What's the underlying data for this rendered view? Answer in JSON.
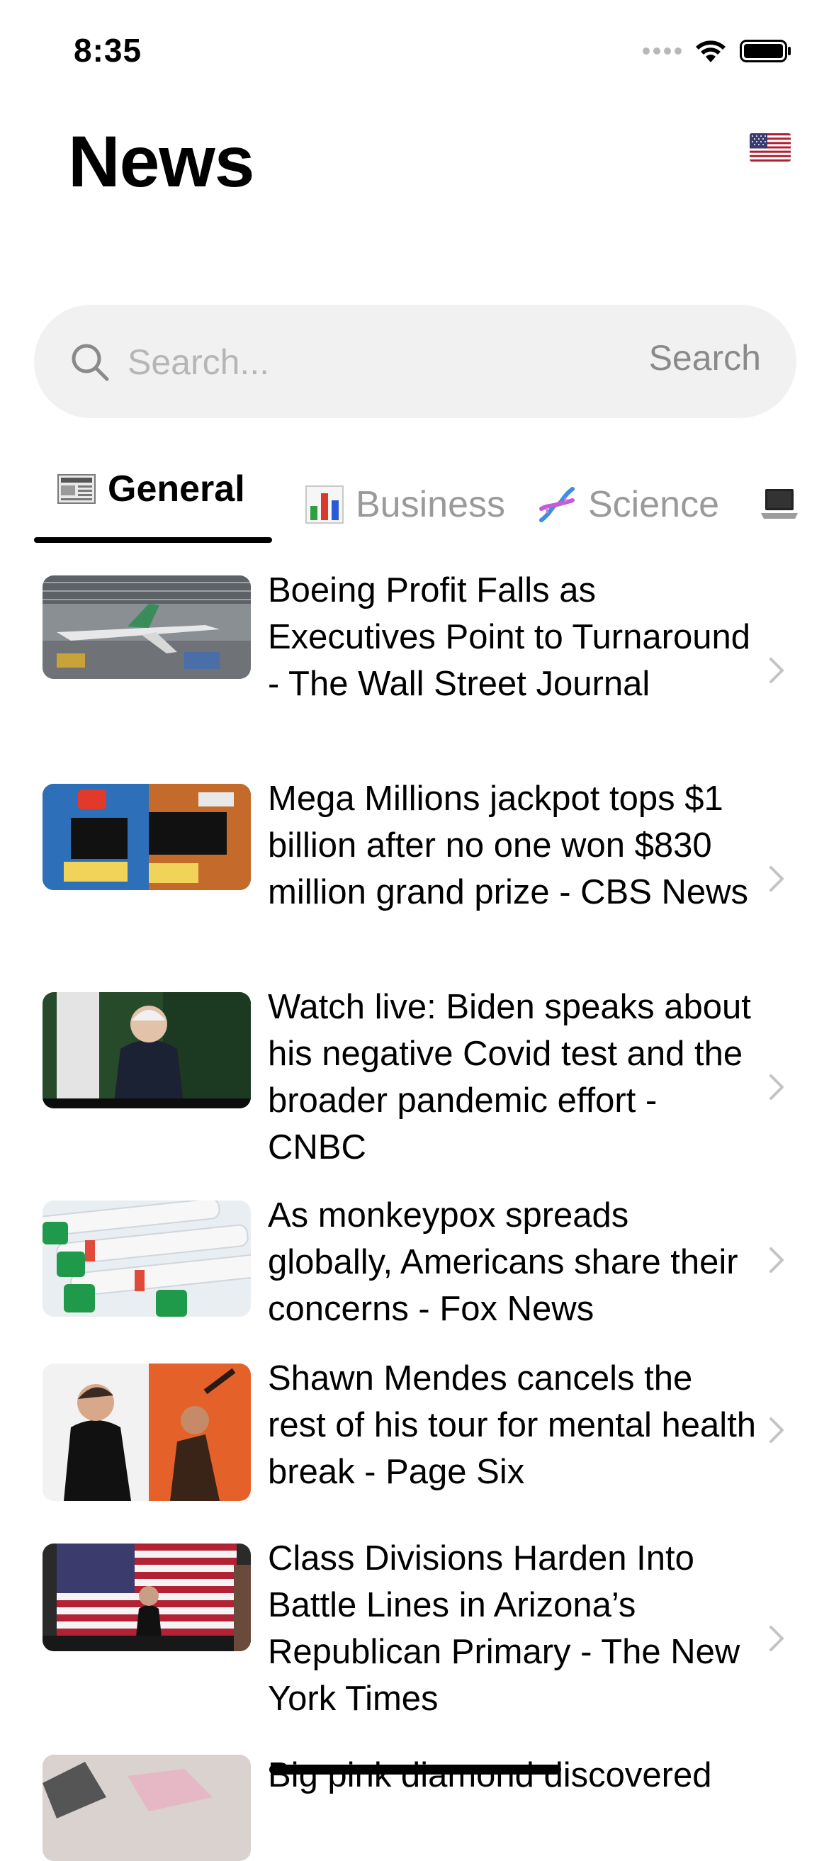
{
  "status_bar": {
    "time": "8:35"
  },
  "header": {
    "title": "News",
    "region_flag": "us-flag-icon"
  },
  "search": {
    "placeholder": "Search...",
    "value": "",
    "button_label": "Search"
  },
  "tabs": [
    {
      "emoji": "newspaper-icon",
      "label": "General",
      "active": true
    },
    {
      "emoji": "bar-chart-icon",
      "label": "Business",
      "active": false
    },
    {
      "emoji": "dna-icon",
      "label": "Science",
      "active": false
    },
    {
      "emoji": "laptop-icon",
      "label": "",
      "active": false
    }
  ],
  "articles": [
    {
      "headline": "Boeing Profit Falls as Executives Point to Turnaround - The Wall Street Journal",
      "thumbnail": "boeing-factory-image"
    },
    {
      "headline": "Mega Millions jackpot tops $1 billion after no one won $830 million grand prize - CBS News",
      "thumbnail": "mega-millions-sign-image"
    },
    {
      "headline": "Watch live: Biden speaks about his negative Covid test and the broader pandemic effort - CNBC",
      "thumbnail": "biden-podium-image"
    },
    {
      "headline": "As monkeypox spreads globally, Americans share their concerns - Fox News",
      "thumbnail": "monkeypox-test-tubes-image"
    },
    {
      "headline": "Shawn Mendes cancels the rest of his tour for mental health break - Page Six",
      "thumbnail": "shawn-mendes-image"
    },
    {
      "headline": "Class Divisions Harden Into Battle Lines in Arizona’s Republican Primary - The New York Times",
      "thumbnail": "american-flag-rally-image"
    },
    {
      "headline": "Big pink diamond discovered",
      "thumbnail": "diamond-image"
    }
  ],
  "colors": {
    "search_background": "#f1f1f1",
    "inactive_tab": "#9a9a9a",
    "active_tab": "#000000",
    "chevron": "#c4c4c4"
  }
}
